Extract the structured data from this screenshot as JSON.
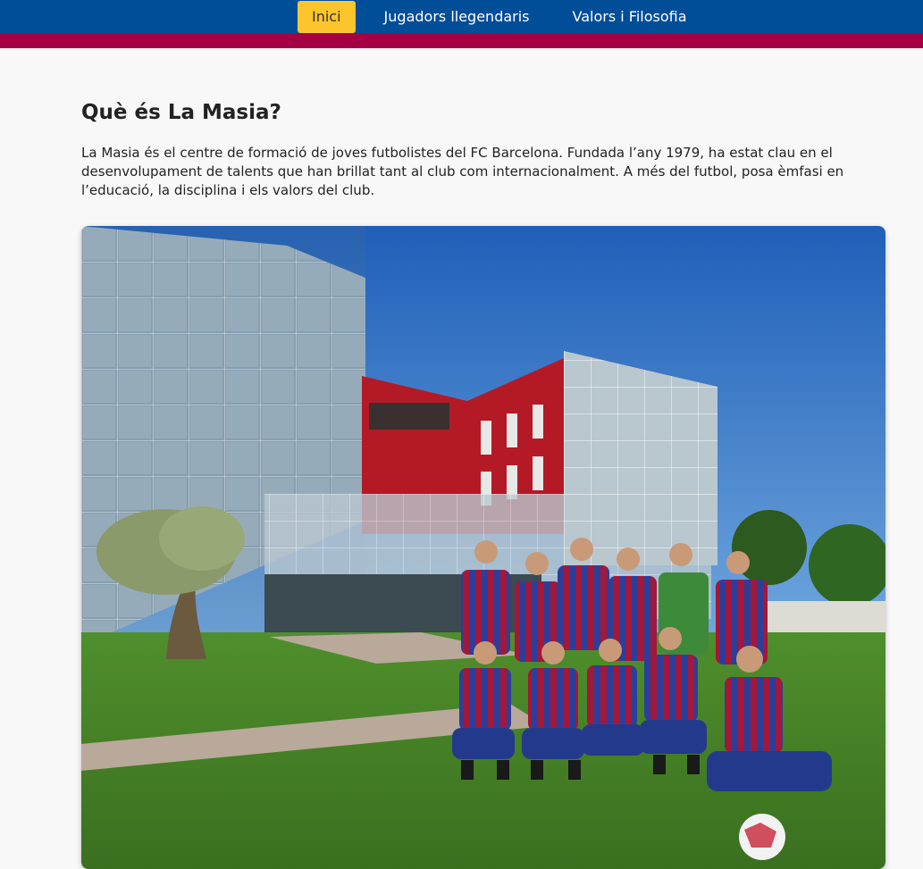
{
  "nav": {
    "items": [
      {
        "label": "Inici",
        "active": true
      },
      {
        "label": "Jugadors llegendaris",
        "active": false
      },
      {
        "label": "Valors i Filosofia",
        "active": false
      }
    ]
  },
  "section": {
    "title": "Què és La Masia?",
    "body": "La Masia és el centre de formació de joves futbolistes del FC Barcelona. Fundada l’any 1979, ha estat clau en el desenvolupament de talents que han brillat tant al club com internacionalment. A més del futbol, posa èmfasi en l’educació, la disciplina i els valors del club."
  },
  "colors": {
    "nav_bg": "#004d98",
    "stripe": "#a50044",
    "active_tab": "#fdc52c"
  }
}
